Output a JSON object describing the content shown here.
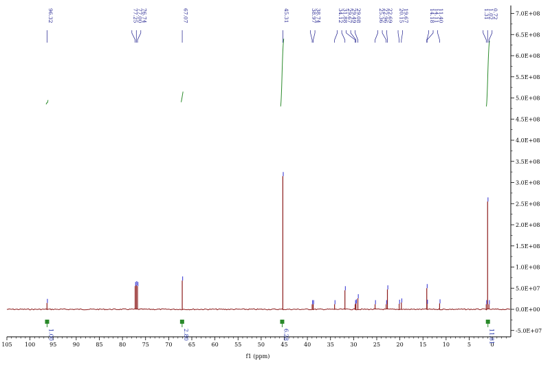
{
  "chart_data": {
    "type": "line",
    "title": "",
    "xlabel": "f1 (ppm)",
    "ylabel": "",
    "xlim": [
      105,
      -4
    ],
    "ylim": [
      -50000000,
      700000000
    ],
    "x_ticks": [
      105,
      100,
      95,
      90,
      85,
      80,
      75,
      70,
      65,
      60,
      55,
      50,
      45,
      40,
      35,
      30,
      25,
      20,
      15,
      10,
      5,
      0
    ],
    "y_ticks": [
      700000000,
      650000000,
      600000000,
      550000000,
      500000000,
      450000000,
      400000000,
      350000000,
      300000000,
      250000000,
      200000000,
      150000000,
      100000000,
      50000000,
      0,
      -50000000
    ],
    "y_tick_labels": [
      "7.0E+08",
      "6.5E+08",
      "6.0E+08",
      "5.5E+08",
      "5.0E+08",
      "4.5E+08",
      "4.0E+08",
      "3.5E+08",
      "3.0E+08",
      "2.5E+08",
      "2.0E+08",
      "1.5E+08",
      "1.0E+08",
      "5.0E+07",
      "0.0E+00",
      "-5.0E+07"
    ],
    "y_axis_position": "right",
    "grid": false,
    "peaks": [
      {
        "x": 96.32,
        "y": 15000000
      },
      {
        "x": 77.25,
        "y": 55000000
      },
      {
        "x": 77.0,
        "y": 57000000
      },
      {
        "x": 76.74,
        "y": 55000000
      },
      {
        "x": 67.07,
        "y": 68000000
      },
      {
        "x": 45.31,
        "y": 315000000
      },
      {
        "x": 38.97,
        "y": 12000000
      },
      {
        "x": 38.74,
        "y": 12000000
      },
      {
        "x": 34.12,
        "y": 12000000
      },
      {
        "x": 31.88,
        "y": 45000000
      },
      {
        "x": 29.67,
        "y": 12000000
      },
      {
        "x": 29.49,
        "y": 14000000
      },
      {
        "x": 29.08,
        "y": 26000000
      },
      {
        "x": 25.36,
        "y": 12000000
      },
      {
        "x": 22.96,
        "y": 12000000
      },
      {
        "x": 22.69,
        "y": 47000000
      },
      {
        "x": 20.15,
        "y": 13000000
      },
      {
        "x": 19.67,
        "y": 16000000
      },
      {
        "x": 14.18,
        "y": 50000000
      },
      {
        "x": 14.11,
        "y": 13000000
      },
      {
        "x": 11.4,
        "y": 14000000
      },
      {
        "x": 1.31,
        "y": 12000000
      },
      {
        "x": 1.02,
        "y": 255000000
      },
      {
        "x": 0.72,
        "y": 12000000
      }
    ],
    "peak_labels": [
      {
        "group": [
          "96.32"
        ],
        "x": 96.32
      },
      {
        "group": [
          "77.25",
          "77.00",
          "76.74"
        ],
        "x": 77.0
      },
      {
        "group": [
          "67.07"
        ],
        "x": 67.07
      },
      {
        "group": [
          "45.31"
        ],
        "x": 45.31
      },
      {
        "group": [
          "38.97",
          "38.74"
        ],
        "x": 38.85
      },
      {
        "group": [
          "34.12",
          "31.88",
          "29.67",
          "29.49",
          "29.08"
        ],
        "x": 31.6
      },
      {
        "group": [
          "25.36",
          "22.96",
          "22.69"
        ],
        "x": 23.8
      },
      {
        "group": [
          "20.15",
          "19.67"
        ],
        "x": 19.9
      },
      {
        "group": [
          "14.18",
          "14.11",
          "11.40"
        ],
        "x": 12.8
      },
      {
        "group": [
          "1.31",
          "1.02",
          "0.72"
        ],
        "x": 1.02
      }
    ],
    "integrals": [
      {
        "x_from": 96.5,
        "x_to": 96.1,
        "y_from": 485000000,
        "y_to": 495000000,
        "label": "1.00"
      },
      {
        "x_from": 67.3,
        "x_to": 66.9,
        "y_from": 490000000,
        "y_to": 515000000,
        "label": "2.80"
      },
      {
        "x_from": 45.8,
        "x_to": 45.1,
        "y_from": 480000000,
        "y_to": 640000000,
        "label": "6.28"
      },
      {
        "x_from": 1.3,
        "x_to": 0.6,
        "y_from": 480000000,
        "y_to": 635000000,
        "label": "11.81"
      }
    ]
  }
}
